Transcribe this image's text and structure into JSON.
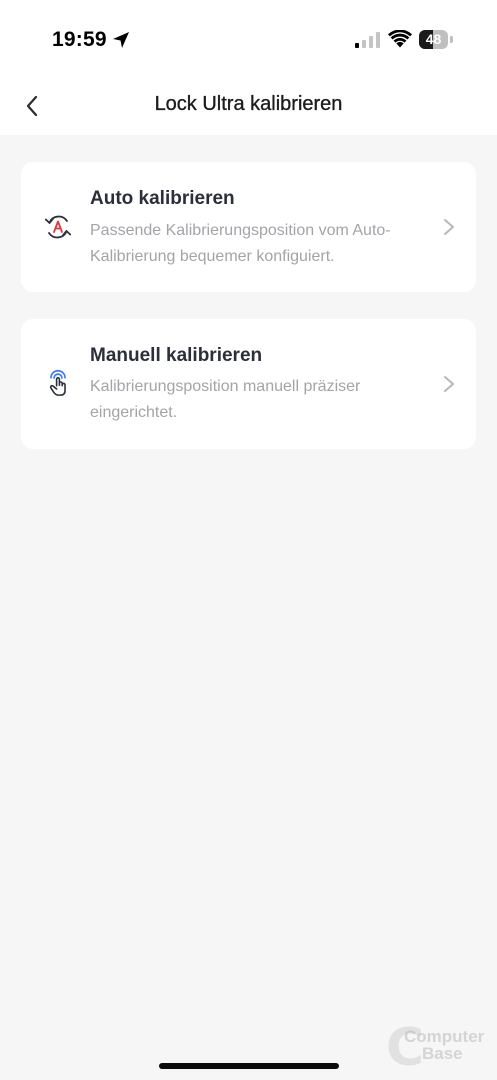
{
  "status_bar": {
    "time": "19:59",
    "battery_level": "48",
    "battery_fraction": 0.48
  },
  "header": {
    "title": "Lock Ultra kalibrieren",
    "back_icon": "chevron-left-icon"
  },
  "options": [
    {
      "title": "Auto kalibrieren",
      "description": "Passende Kalibrierungsposition vom Auto-Kalibrierung bequemer konfiguiert.",
      "icon": "auto-calibrate-icon",
      "accent_color": "#e3393c"
    },
    {
      "title": "Manuell kalibrieren",
      "description": "Kalibrierungsposition manuell präziser eingerichtet.",
      "icon": "manual-calibrate-icon",
      "accent_color": "#3a7bf2"
    }
  ],
  "watermark": {
    "letter": "C",
    "line1": "Computer",
    "line2": "Base"
  },
  "colors": {
    "background": "#f6f6f6",
    "card": "#ffffff",
    "title_text": "#2c2f3a",
    "description_text": "#a2a4a8",
    "chevron": "#b5b7bb"
  }
}
